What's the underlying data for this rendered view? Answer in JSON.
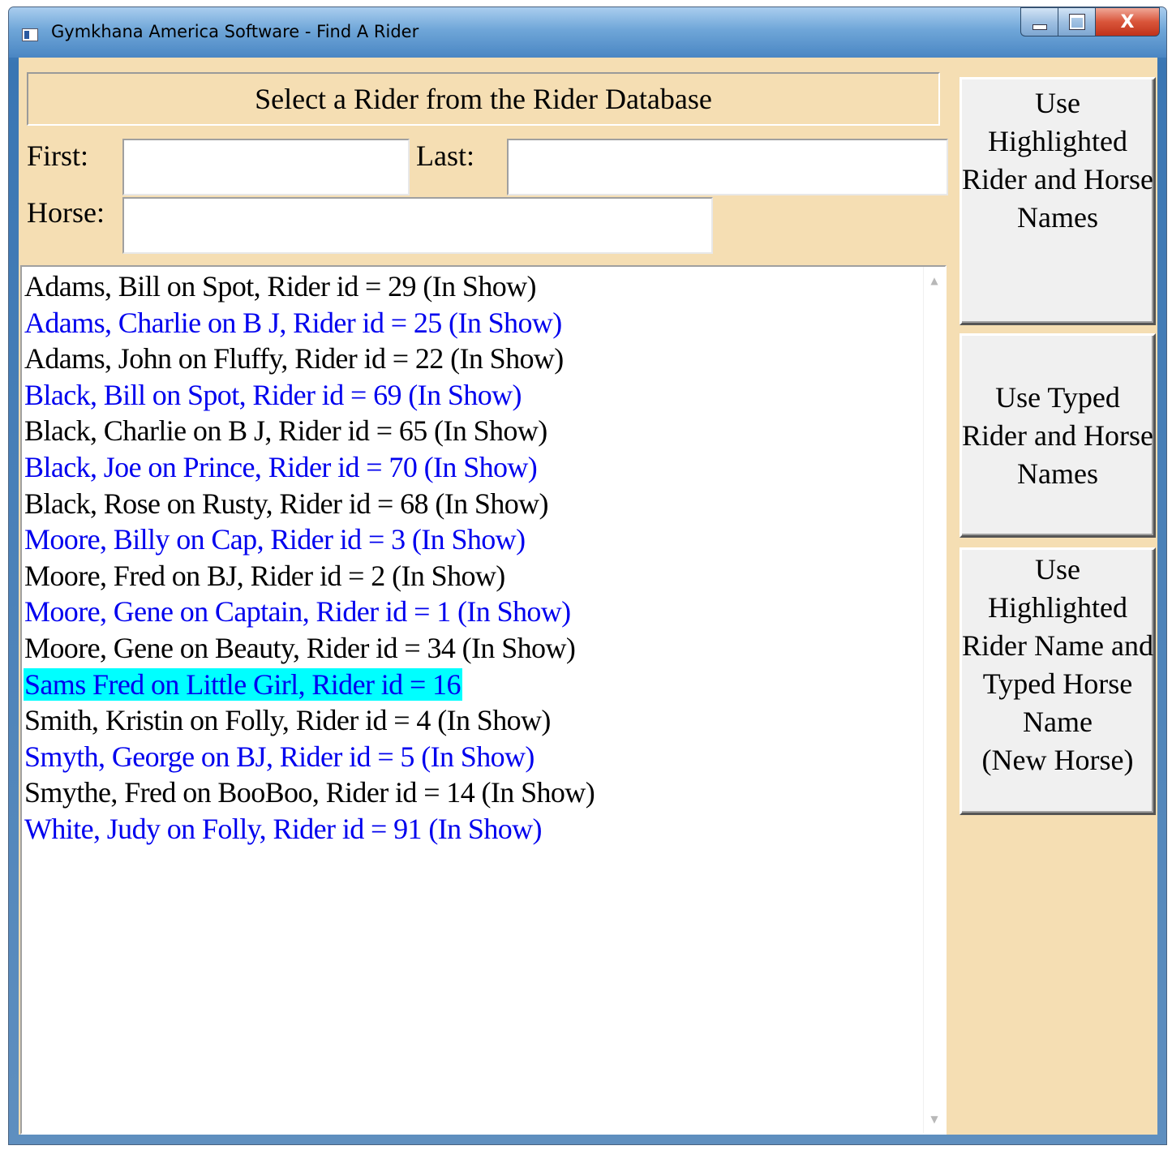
{
  "window": {
    "title": "Gymkhana America Software - Find A Rider",
    "controls": {
      "minimize": "minimize",
      "maximize": "maximize",
      "close": "X"
    }
  },
  "header": "Select a Rider from the Rider Database",
  "form": {
    "first_label": "First:",
    "first_value": "",
    "last_label": "Last:",
    "last_value": "",
    "horse_label": "Horse:",
    "horse_value": ""
  },
  "riders": [
    {
      "text": "Adams, Bill on Spot, Rider id = 29 (In Show)",
      "color": "#000000",
      "selected": false
    },
    {
      "text": "Adams, Charlie on B J, Rider id = 25 (In Show)",
      "color": "#0000ee",
      "selected": false
    },
    {
      "text": "Adams, John on Fluffy, Rider id = 22 (In Show)",
      "color": "#000000",
      "selected": false
    },
    {
      "text": "Black, Bill on Spot, Rider id = 69 (In Show)",
      "color": "#0000ee",
      "selected": false
    },
    {
      "text": "Black, Charlie on B J, Rider id = 65 (In Show)",
      "color": "#000000",
      "selected": false
    },
    {
      "text": "Black, Joe on Prince, Rider id = 70 (In Show)",
      "color": "#0000ee",
      "selected": false
    },
    {
      "text": "Black, Rose on Rusty, Rider id = 68 (In Show)",
      "color": "#000000",
      "selected": false
    },
    {
      "text": "Moore, Billy on Cap, Rider id = 3 (In Show)",
      "color": "#0000ee",
      "selected": false
    },
    {
      "text": "Moore, Fred on BJ, Rider id = 2 (In Show)",
      "color": "#000000",
      "selected": false
    },
    {
      "text": "Moore, Gene on Captain, Rider id = 1 (In Show)",
      "color": "#0000ee",
      "selected": false
    },
    {
      "text": "Moore, Gene on Beauty, Rider id = 34 (In Show)",
      "color": "#000000",
      "selected": false
    },
    {
      "text": "Sams Fred on Little Girl, Rider id = 16",
      "color": "#0000ee",
      "selected": true
    },
    {
      "text": "Smith, Kristin on Folly, Rider id = 4 (In Show)",
      "color": "#000000",
      "selected": false
    },
    {
      "text": "Smyth, George on BJ, Rider id = 5 (In Show)",
      "color": "#0000ee",
      "selected": false
    },
    {
      "text": "Smythe, Fred on BooBoo, Rider id = 14 (In Show)",
      "color": "#000000",
      "selected": false
    },
    {
      "text": "White, Judy on Folly, Rider id = 91 (In Show)",
      "color": "#0000ee",
      "selected": false
    }
  ],
  "scrollbar": {
    "up_glyph": "▲",
    "down_glyph": "▼"
  },
  "buttons": {
    "use_highlighted": "Use Highlighted\nRider and Horse\nNames",
    "use_typed": "Use Typed\nRider and Horse\nNames",
    "use_highlighted_new_horse": "Use Highlighted\nRider Name and\nTyped Horse\nName\n(New Horse)"
  },
  "colors": {
    "client_background": "#f5deb3",
    "selection_highlight": "#00ffff",
    "row_black": "#000000",
    "row_blue": "#0000ee"
  }
}
